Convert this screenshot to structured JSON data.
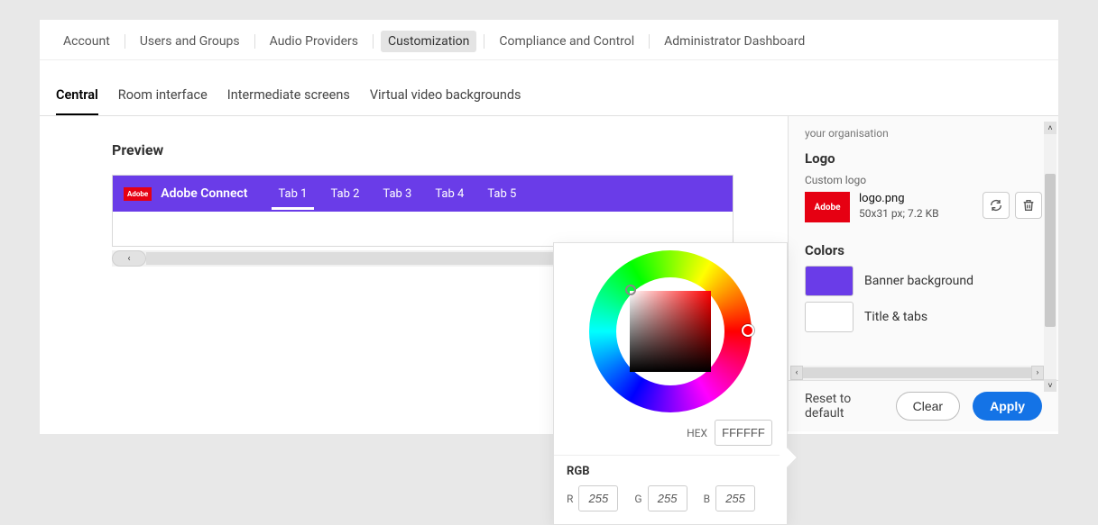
{
  "topnav": {
    "items": [
      {
        "label": "Account"
      },
      {
        "label": "Users and Groups"
      },
      {
        "label": "Audio Providers"
      },
      {
        "label": "Customization",
        "active": true
      },
      {
        "label": "Compliance and Control"
      },
      {
        "label": "Administrator Dashboard"
      }
    ]
  },
  "subtabs": {
    "items": [
      {
        "label": "Central",
        "active": true
      },
      {
        "label": "Room interface"
      },
      {
        "label": "Intermediate screens"
      },
      {
        "label": "Virtual video backgrounds"
      }
    ]
  },
  "preview": {
    "title": "Preview",
    "logo_text": "Adobe",
    "brand": "Adobe Connect",
    "tabs": [
      {
        "label": "Tab 1",
        "active": true
      },
      {
        "label": "Tab 2"
      },
      {
        "label": "Tab 3"
      },
      {
        "label": "Tab 4"
      },
      {
        "label": "Tab 5"
      }
    ]
  },
  "picker": {
    "hex_label": "HEX",
    "hex_value": "FFFFFF",
    "rgb_label": "RGB",
    "r_label": "R",
    "g_label": "G",
    "b_label": "B",
    "r": "255",
    "g": "255",
    "b": "255"
  },
  "side": {
    "note": "your organisation",
    "logo_heading": "Logo",
    "custom_logo_label": "Custom logo",
    "logo_thumb_text": "Adobe",
    "logo_filename": "logo.png",
    "logo_meta": "50x31 px; 7.2 KB",
    "colors_heading": "Colors",
    "color_rows": [
      {
        "label": "Banner background",
        "hex": "#6a3ce8"
      },
      {
        "label": "Title & tabs",
        "hex": "#ffffff"
      }
    ]
  },
  "footer": {
    "reset": "Reset to default",
    "clear": "Clear",
    "apply": "Apply"
  }
}
